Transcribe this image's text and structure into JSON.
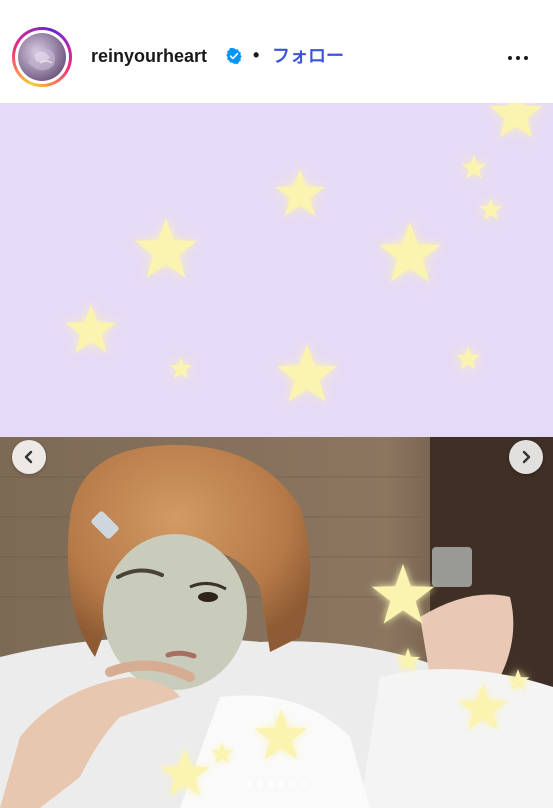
{
  "header": {
    "username": "reinyourheart",
    "separator": "•",
    "follow_label": "フォロー",
    "verified_icon": "verified-badge-icon",
    "more_icon": "more-horizontal-icon"
  },
  "post": {
    "nav_prev_icon": "chevron-left-icon",
    "nav_next_icon": "chevron-right-icon",
    "carousel": {
      "total": 6,
      "active_index": 2
    }
  },
  "colors": {
    "link": "#3c55d8",
    "verified": "#0095f6",
    "lavender_bg": "#e6dbf6",
    "star": "#fbf3b0"
  }
}
